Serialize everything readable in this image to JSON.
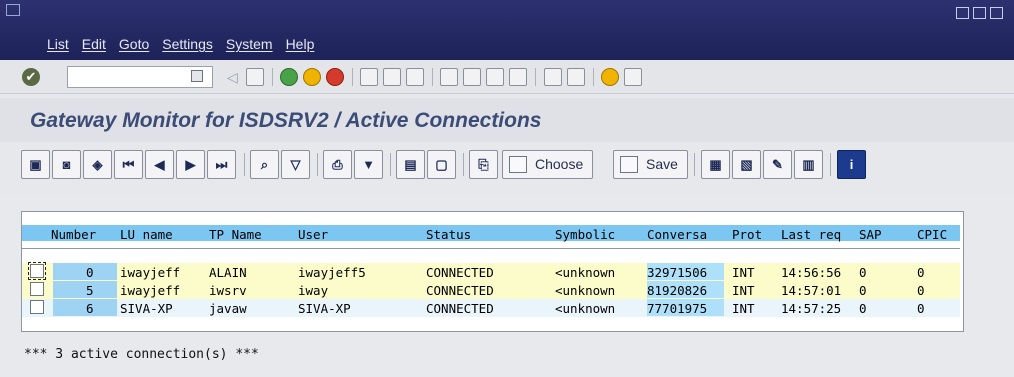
{
  "menu": [
    "List",
    "Edit",
    "Goto",
    "Settings",
    "System",
    "Help"
  ],
  "title": "Gateway Monitor for ISDSRV2 / Active Connections",
  "toolbar": {
    "choose_label": "Choose",
    "save_label": "Save"
  },
  "table": {
    "headers": [
      "Number",
      "LU name",
      "TP Name",
      "User",
      "Status",
      "Symbolic",
      "Conversa",
      "Prot",
      "Last req",
      "SAP",
      "CPIC"
    ],
    "rows": [
      [
        "0",
        "iwayjeff",
        "ALAIN",
        "iwayjeff5",
        "CONNECTED",
        "<unknown",
        "32971506",
        "INT",
        "14:56:56",
        "0",
        "0"
      ],
      [
        "5",
        "iwayjeff",
        "iwsrv",
        "iway",
        "CONNECTED",
        "<unknown",
        "81920826",
        "INT",
        "14:57:01",
        "0",
        "0"
      ],
      [
        "6",
        "SIVA-XP",
        "javaw",
        "SIVA-XP",
        "CONNECTED",
        "<unknown",
        "77701975",
        "INT",
        "14:57:25",
        "0",
        "0"
      ]
    ]
  },
  "footer": "*** 3 active connection(s) ***",
  "colors": {
    "menubar": "#2d3170",
    "header_row": "#7cc6f2",
    "row_yellow": "#fbfcc9",
    "row_blue": "#e9f4fb",
    "title_text": "#3b4c77"
  }
}
